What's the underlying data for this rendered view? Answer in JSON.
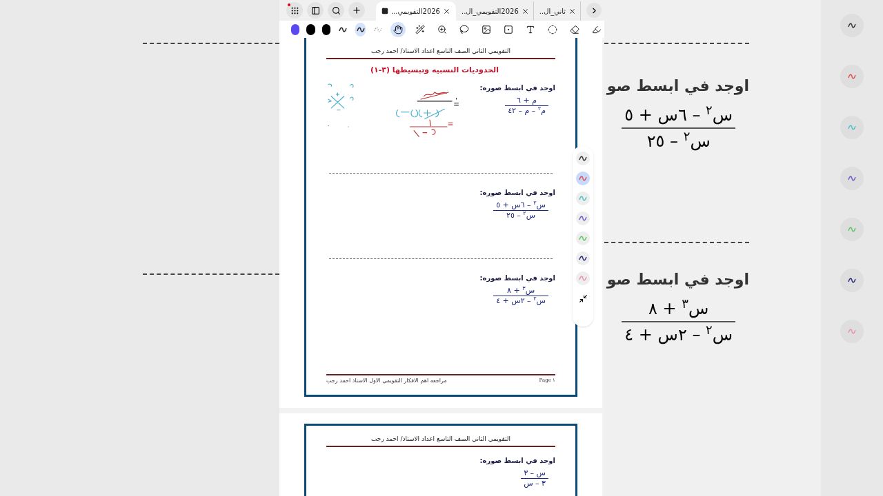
{
  "tabs": [
    {
      "title": "ثاني_ال..",
      "selected": false
    },
    {
      "title": "2026التقويمي_ال..",
      "selected": false
    },
    {
      "title": "2026التقويمي...",
      "selected": true
    }
  ],
  "toolbar": {
    "colors": [
      {
        "color": "#5a48f0",
        "selected": false
      },
      {
        "color": "#000000",
        "selected": false
      },
      {
        "color": "#000000",
        "selected": false
      }
    ],
    "pens": [
      {
        "kind": "pen",
        "selected": false
      },
      {
        "kind": "pen",
        "selected": true
      },
      {
        "kind": "pencil",
        "selected": false
      }
    ],
    "tools": [
      {
        "kind": "hand",
        "selected": true
      },
      {
        "kind": "laser",
        "selected": false
      },
      {
        "kind": "zoom",
        "selected": false
      },
      {
        "kind": "lasso",
        "selected": false
      },
      {
        "kind": "image",
        "selected": false
      },
      {
        "kind": "shape",
        "selected": false
      },
      {
        "kind": "text",
        "selected": false
      },
      {
        "kind": "select",
        "selected": false
      },
      {
        "kind": "eraser",
        "selected": false
      },
      {
        "kind": "highlighter",
        "selected": false
      }
    ]
  },
  "pages": [
    {
      "header": "التقويمي الثاني  الصف التاسع  اعداد  الاستاذ/ احمد رجب",
      "title": "الحدوديات النسبيه وتبسيطها (٣-١)",
      "problems": [
        {
          "prompt": "اوجد في ابسط صوره:",
          "numerator": "م + ٦",
          "denominator": "م$^{٢}$ – م – ٤٢",
          "annotated": true
        },
        {
          "prompt": "اوجد في ابسط صوره:",
          "numerator": "س$^{٢}$ – ٦س + ٥",
          "denominator": "س$^{٢}$ – ٢٥",
          "annotated": false
        },
        {
          "prompt": "اوجد في ابسط صوره:",
          "numerator": "س$^{٣}$ + ٨",
          "denominator": "س$^{٢}$ – ٢س + ٤",
          "annotated": false
        }
      ],
      "footer_left": "مراجعه اهم الافكار التقويمي الاول   الاستاذ احمد رجب",
      "footer_right": "Page ١"
    },
    {
      "header": "التقويمي الثاني  الصف التاسع  اعداد  الاستاذ/ احمد رجب",
      "problems": [
        {
          "prompt": "اوجد في ابسط صوره:",
          "numerator": "س – ٣",
          "denominator": "٣ – س",
          "annotated": false
        }
      ]
    }
  ],
  "pen_palette": [
    {
      "color": "#333333",
      "selected": false
    },
    {
      "color": "#e05050",
      "selected": true
    },
    {
      "color": "#50c0c8",
      "selected": false
    },
    {
      "color": "#6a5acd",
      "selected": false
    },
    {
      "color": "#5cc85c",
      "selected": false
    },
    {
      "color": "#2a2a80",
      "selected": false
    },
    {
      "color": "#e890b0",
      "selected": false
    }
  ],
  "background_right": {
    "problems": [
      {
        "prompt": "اوجد في ابسط صو",
        "numerator": "س$^{٢}$ – ٦س + ٥",
        "denominator": "س$^{٢}$ – ٢٥"
      },
      {
        "prompt": "اوجد في ابسط صو",
        "numerator": "س$^{٣}$ + ٨",
        "denominator": "س$^{٢}$ – ٢س + ٤"
      }
    ]
  }
}
